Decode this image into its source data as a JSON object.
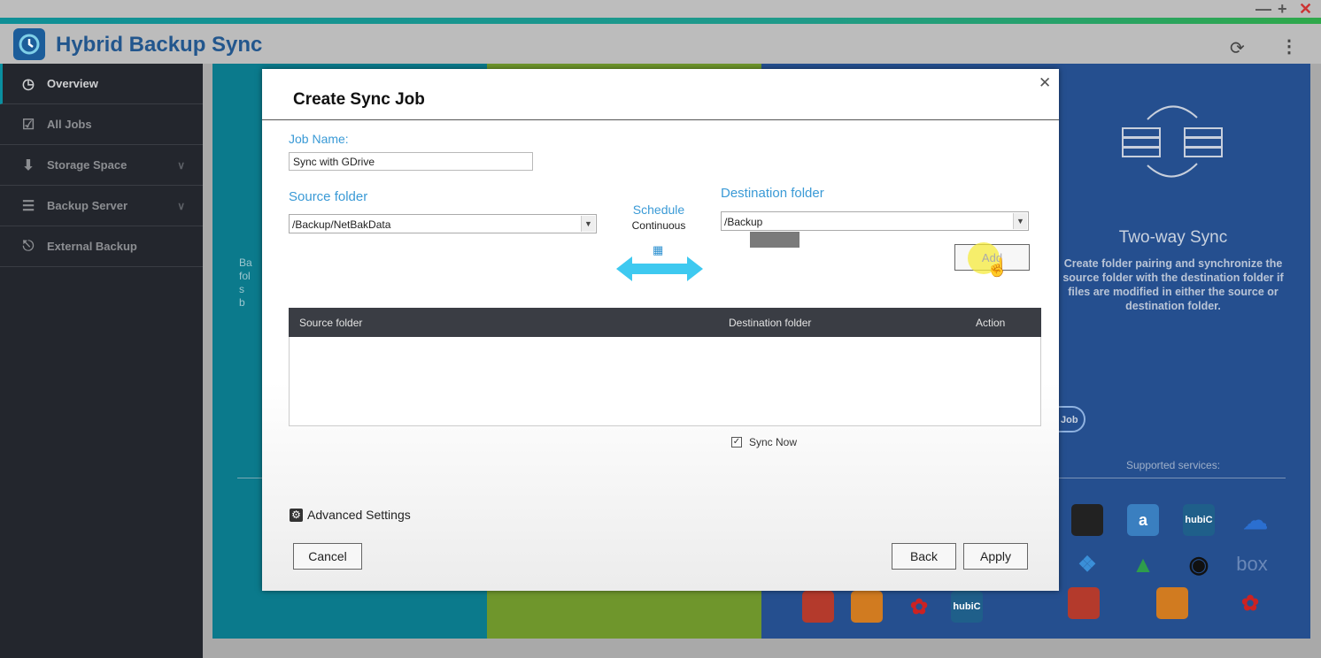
{
  "app": {
    "title": "Hybrid Backup Sync",
    "window_controls": [
      "minimize",
      "maximize",
      "close"
    ]
  },
  "sidebar": {
    "items": [
      {
        "label": "Overview",
        "icon": "dashboard-icon",
        "active": true
      },
      {
        "label": "All Jobs",
        "icon": "checklist-icon"
      },
      {
        "label": "Storage Space",
        "icon": "storage-icon",
        "expandable": true
      },
      {
        "label": "Backup Server",
        "icon": "server-icon",
        "expandable": true
      },
      {
        "label": "External Backup",
        "icon": "external-drive-icon"
      }
    ]
  },
  "background": {
    "left_text": "Ba\nfol\ns\nb",
    "two_way": {
      "title": "Two-way Sync",
      "description": "Create folder pairing and synchronize the source folder with the destination folder if files are modified in either the source or destination folder.",
      "button_partial": "Job"
    },
    "supported_label": "Supported services:",
    "services": [
      "nas",
      "amazon-drive",
      "hubic",
      "onedrive",
      "dropbox",
      "google-drive",
      "ufo",
      "box",
      "amazon-s3",
      "azure",
      "backblaze",
      "hubic"
    ]
  },
  "dialog": {
    "title": "Create Sync Job",
    "job_name_label": "Job Name:",
    "job_name_value": "Sync with GDrive",
    "source_label": "Source folder",
    "source_value": "/Backup/NetBakData",
    "schedule_label": "Schedule",
    "schedule_value": "Continuous",
    "dest_label": "Destination folder",
    "dest_value": "/Backup",
    "add_label": "Add",
    "table": {
      "headers": [
        "Source folder",
        "Destination folder",
        "Action"
      ],
      "rows": []
    },
    "sync_now_label": "Sync Now",
    "sync_now_checked": true,
    "advanced_label": "Advanced Settings",
    "cancel_label": "Cancel",
    "back_label": "Back",
    "apply_label": "Apply"
  },
  "colors": {
    "accent_blue": "#3a9ad6",
    "sidebar": "#23262d",
    "panel_blue": "#254f8f",
    "panel_teal": "#0b7a8c",
    "panel_green": "#6f962c"
  }
}
